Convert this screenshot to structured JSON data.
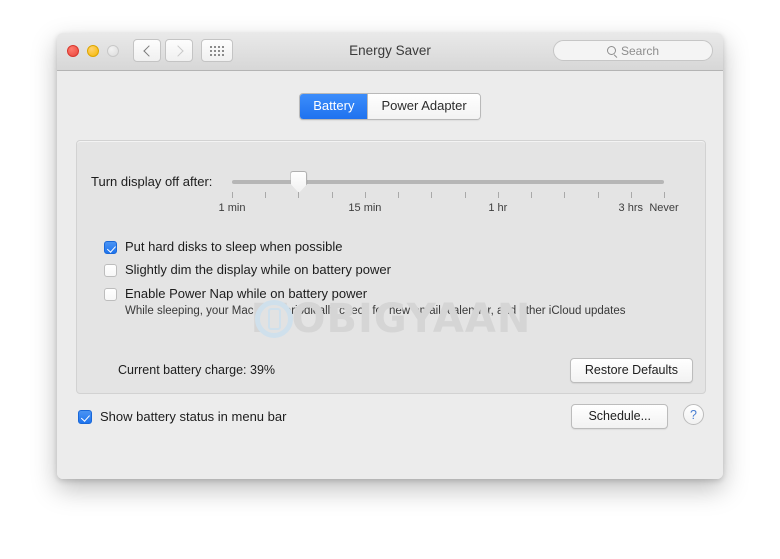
{
  "window": {
    "title": "Energy Saver",
    "traffic_lights": [
      "close",
      "minimize",
      "zoom"
    ],
    "nav": {
      "back": "back-chevron",
      "forward": "forward-chevron",
      "grid": "show-all-grid"
    },
    "search": {
      "placeholder": "Search",
      "value": ""
    }
  },
  "tabs": [
    {
      "label": "Battery",
      "active": true
    },
    {
      "label": "Power Adapter",
      "active": false
    }
  ],
  "slider": {
    "label": "Turn display off after:",
    "tick_labels": [
      "1 min",
      "15 min",
      "1 hr",
      "3 hrs",
      "Never"
    ],
    "tick_count": 14,
    "thumb_position_index": 2
  },
  "checkboxes": [
    {
      "label": "Put hard disks to sleep when possible",
      "checked": true
    },
    {
      "label": "Slightly dim the display while on battery power",
      "checked": false
    },
    {
      "label": "Enable Power Nap while on battery power",
      "checked": false
    }
  ],
  "powernap_description": "While sleeping, your Mac can periodically check for new email, calendar, and other iCloud updates",
  "watermark": {
    "text": "MOBIGYAAN",
    "accent_color": "#cfe0ec"
  },
  "status": {
    "battery_charge": "Current battery charge: 39%"
  },
  "buttons": {
    "restore_defaults": "Restore Defaults",
    "schedule": "Schedule...",
    "help": "?"
  },
  "footer": {
    "menu_bar_checkbox": {
      "label": "Show battery status in menu bar",
      "checked": true
    }
  },
  "colors": {
    "accent_blue": "#1f72ef",
    "window_bg": "#ececec",
    "panel_bg": "#e4e4e4"
  }
}
